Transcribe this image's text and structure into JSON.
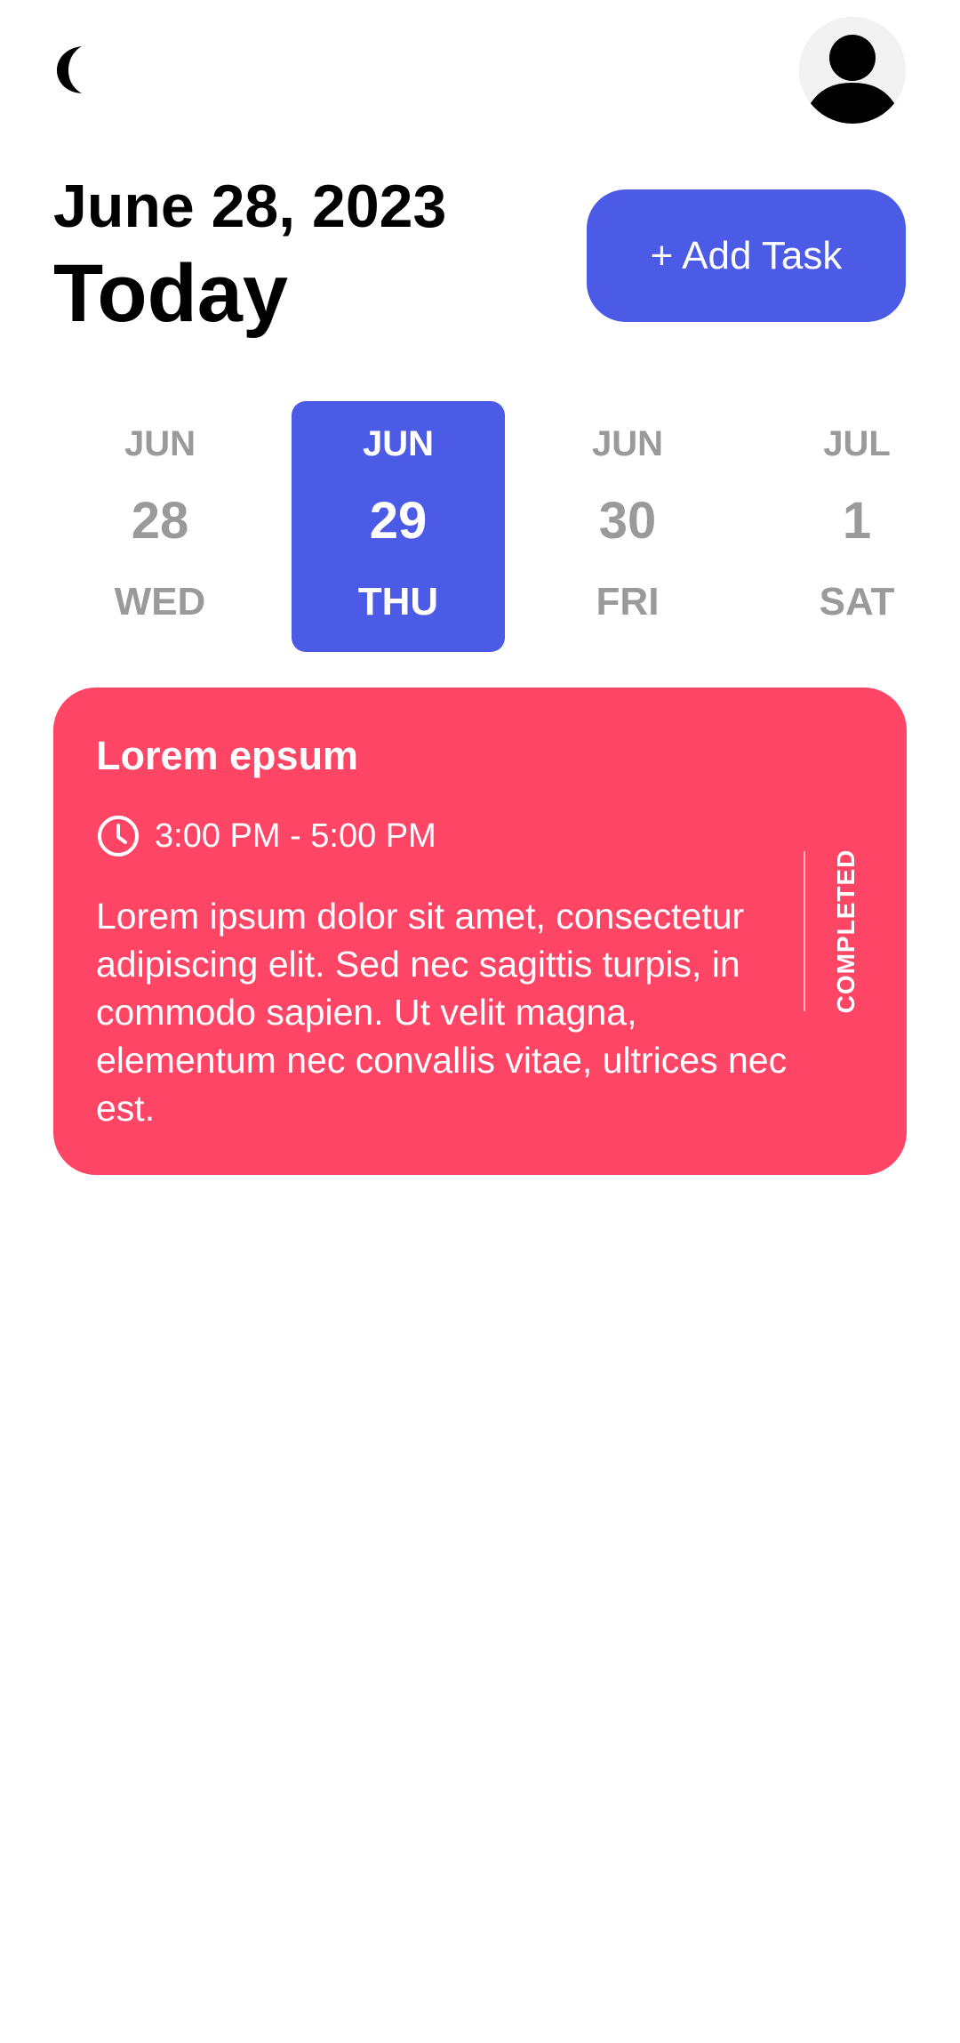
{
  "header": {
    "theme_icon": "crescent-moon-icon",
    "avatar_icon": "user-avatar-icon",
    "date": "June 28, 2023",
    "title": "Today",
    "add_task_label": "+ Add Task"
  },
  "days": [
    {
      "month": "JUN",
      "day": "28",
      "weekday": "WED",
      "selected": false
    },
    {
      "month": "JUN",
      "day": "29",
      "weekday": "THU",
      "selected": true
    },
    {
      "month": "JUN",
      "day": "30",
      "weekday": "FRI",
      "selected": false
    },
    {
      "month": "JUL",
      "day": "1",
      "weekday": "SAT",
      "selected": false
    }
  ],
  "tasks": [
    {
      "title": "Lorem epsum",
      "time": "3:00 PM - 5:00 PM",
      "time_icon": "clock-icon",
      "description": "Lorem ipsum dolor sit amet, consectetur adipiscing elit. Sed nec sagittis turpis, in commodo sapien. Ut velit magna, elementum nec convallis vitae, ultrices nec est.",
      "status": "COMPLETED",
      "color": "#ff4566"
    }
  ],
  "colors": {
    "accent": "#4c5be6",
    "task_card": "#ff4566",
    "muted_text": "#9a9a9a"
  }
}
